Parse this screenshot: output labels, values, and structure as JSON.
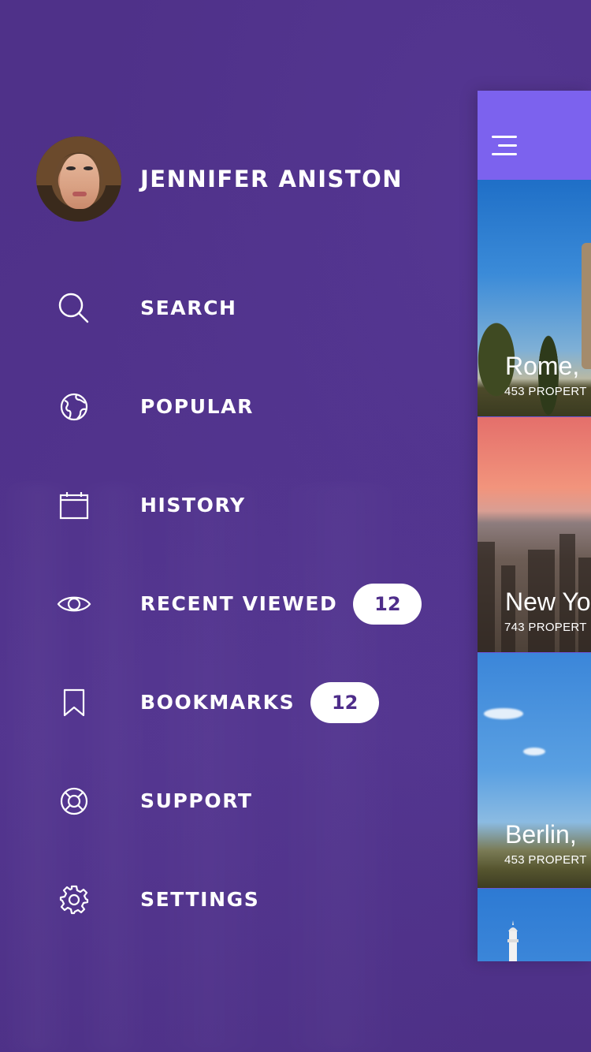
{
  "user": {
    "name": "JENNIFER ANISTON"
  },
  "menu": [
    {
      "id": "search",
      "label": "SEARCH",
      "icon": "search-icon"
    },
    {
      "id": "popular",
      "label": "POPULAR",
      "icon": "globe-icon"
    },
    {
      "id": "history",
      "label": "HISTORY",
      "icon": "calendar-icon"
    },
    {
      "id": "recent-viewed",
      "label": "RECENT VIEWED",
      "icon": "eye-icon",
      "badge": "12"
    },
    {
      "id": "bookmarks",
      "label": "BOOKMARKS",
      "icon": "bookmark-icon",
      "badge": "12"
    },
    {
      "id": "support",
      "label": "SUPPORT",
      "icon": "lifebuoy-icon"
    },
    {
      "id": "settings",
      "label": "SETTINGS",
      "icon": "gear-icon"
    }
  ],
  "preview": {
    "cards": [
      {
        "city": "Rome,",
        "properties": "453 PROPERT"
      },
      {
        "city": "New Yo",
        "properties": "743 PROPERT"
      },
      {
        "city": "Berlin,",
        "properties": "453 PROPERT"
      }
    ]
  },
  "colors": {
    "background": "#4e3188",
    "header": "#7c62ee",
    "badge_bg": "#ffffff",
    "badge_text": "#4e2d8a"
  }
}
